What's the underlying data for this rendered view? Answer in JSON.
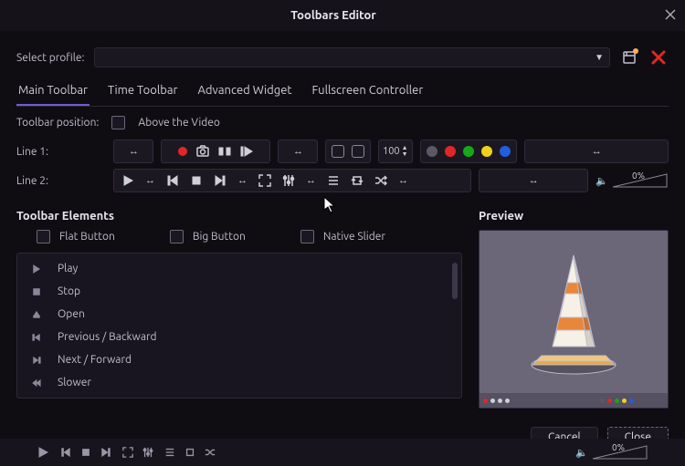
{
  "window": {
    "title": "Toolbars Editor"
  },
  "profile": {
    "label": "Select profile:",
    "value": ""
  },
  "tabs": [
    {
      "label": "Main Toolbar",
      "active": true
    },
    {
      "label": "Time Toolbar",
      "active": false
    },
    {
      "label": "Advanced Widget",
      "active": false
    },
    {
      "label": "Fullscreen Controller",
      "active": false
    }
  ],
  "toolbar_position": {
    "label": "Toolbar position:",
    "checkbox_label": "Above the Video",
    "checked": false
  },
  "line1": {
    "label": "Line 1:",
    "number": "100"
  },
  "line2": {
    "label": "Line 2:",
    "volume_pct": "0%"
  },
  "elements": {
    "header": "Toolbar Elements",
    "preview_header": "Preview",
    "options": [
      {
        "label": "Flat Button",
        "checked": false
      },
      {
        "label": "Big Button",
        "checked": false
      },
      {
        "label": "Native Slider",
        "checked": false
      }
    ],
    "list": [
      {
        "icon": "play",
        "label": "Play"
      },
      {
        "icon": "stop",
        "label": "Stop"
      },
      {
        "icon": "open",
        "label": "Open"
      },
      {
        "icon": "prev",
        "label": "Previous / Backward"
      },
      {
        "icon": "next",
        "label": "Next / Forward"
      },
      {
        "icon": "slower",
        "label": "Slower"
      }
    ]
  },
  "buttons": {
    "cancel": "Cancel",
    "close": "Close"
  },
  "player": {
    "volume_pct": "0%"
  }
}
